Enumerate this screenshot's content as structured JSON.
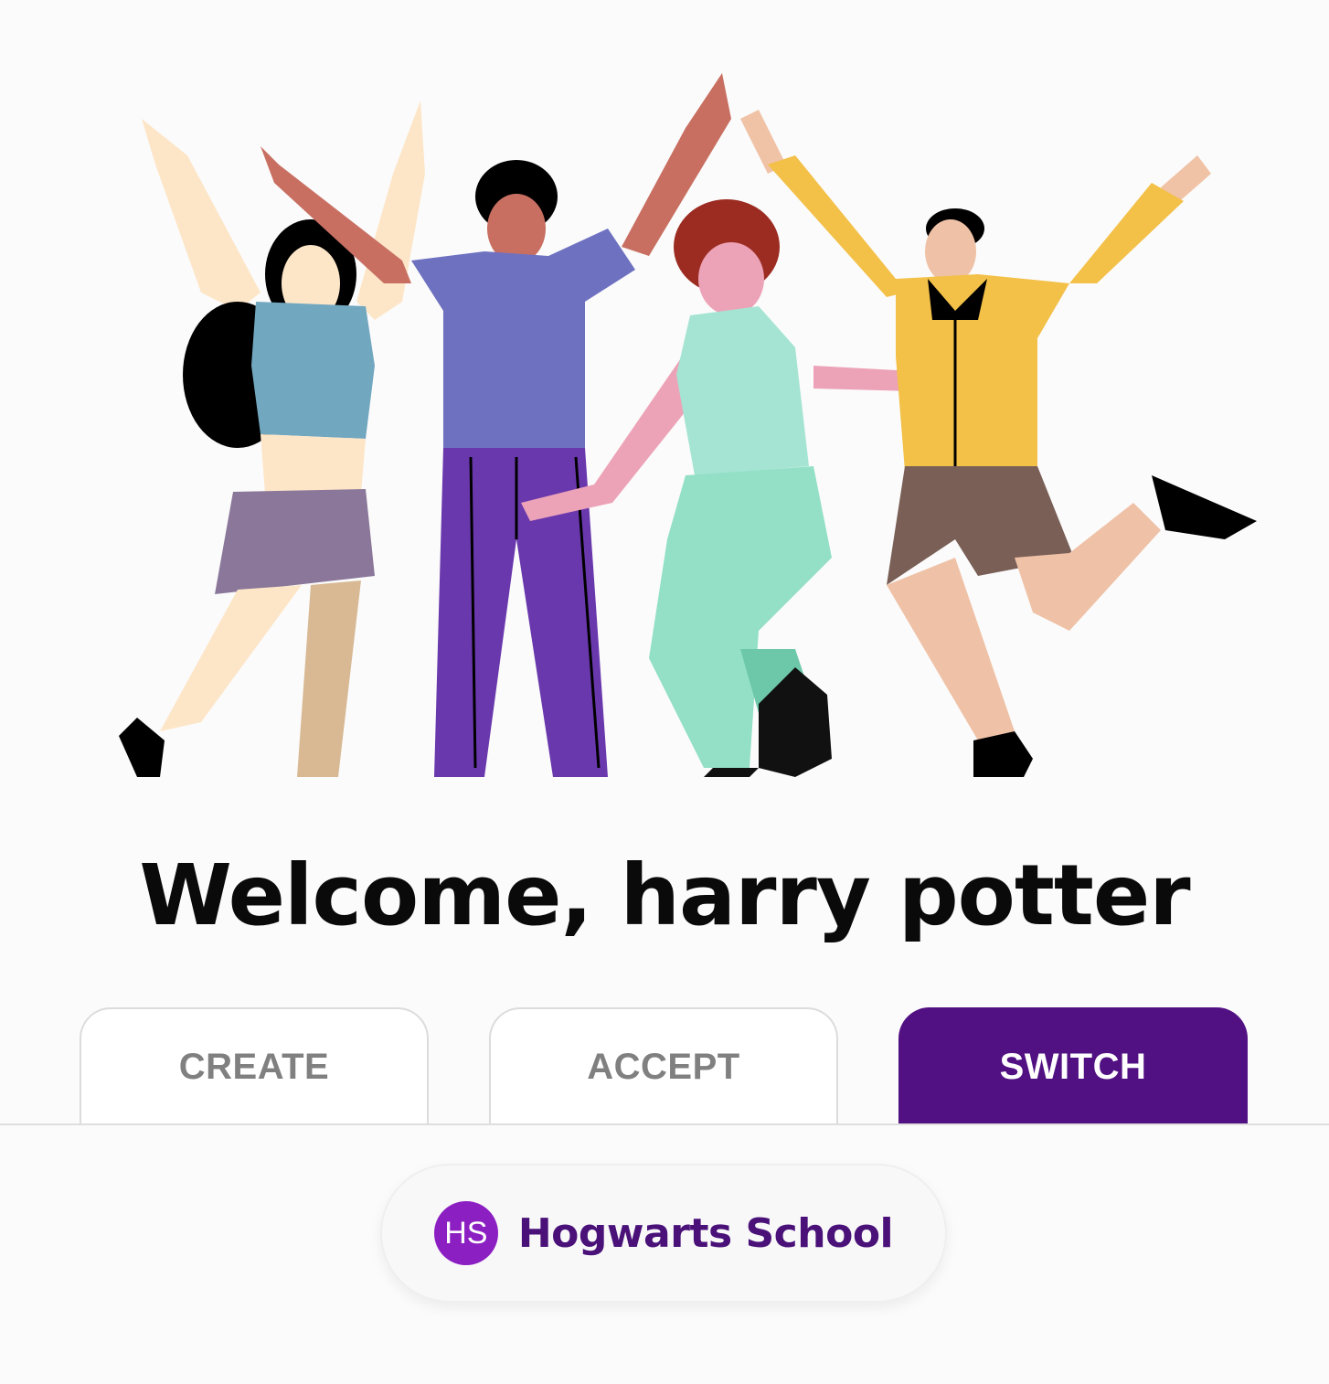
{
  "hero": {
    "image": "people-celebrating-illustration"
  },
  "welcome": {
    "title": "Welcome, harry potter"
  },
  "tabs": [
    {
      "label": "CREATE",
      "active": false
    },
    {
      "label": "ACCEPT",
      "active": false
    },
    {
      "label": "SWITCH",
      "active": true
    }
  ],
  "school": {
    "initials": "HS",
    "name": "Hogwarts School"
  },
  "colors": {
    "background": "#fbfbfb",
    "accent": "#521183",
    "avatar": "#8c1fc2",
    "school_text": "#4a1179",
    "tab_inactive_text": "#808080"
  }
}
